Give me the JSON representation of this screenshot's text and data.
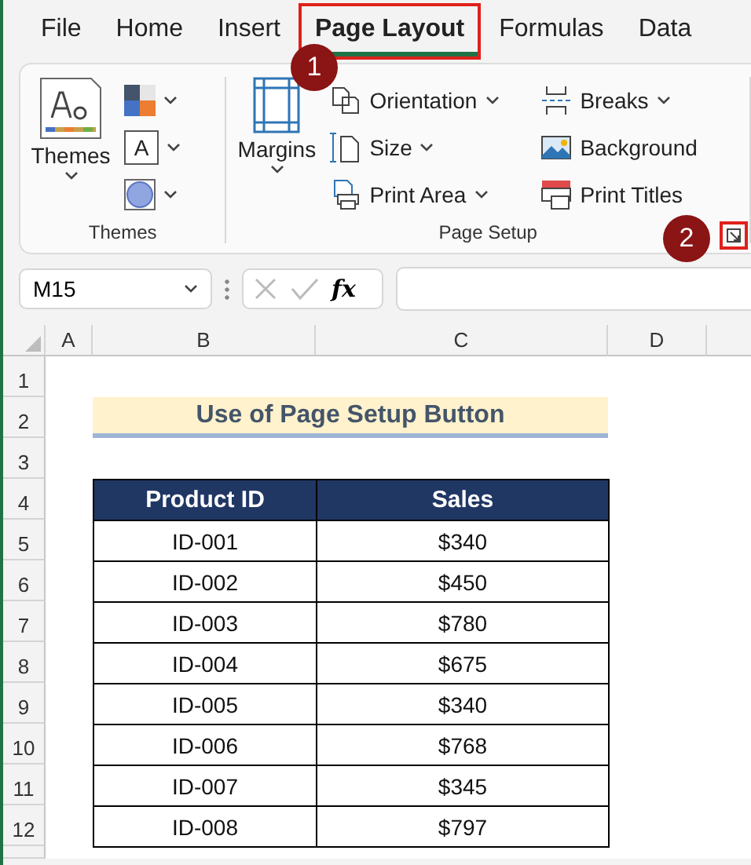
{
  "tabs": [
    {
      "label": "File",
      "selected": false,
      "highlighted": false
    },
    {
      "label": "Home",
      "selected": false,
      "highlighted": false
    },
    {
      "label": "Insert",
      "selected": false,
      "highlighted": false
    },
    {
      "label": "Page Layout",
      "selected": true,
      "highlighted": true
    },
    {
      "label": "Formulas",
      "selected": false,
      "highlighted": false
    },
    {
      "label": "Data",
      "selected": false,
      "highlighted": false
    }
  ],
  "ribbon": {
    "themes_group": {
      "label": "Themes",
      "themes_button": "Themes",
      "font_icon_letter": "A"
    },
    "page_setup_group": {
      "label": "Page Setup",
      "margins_button": "Margins",
      "buttons": [
        {
          "kind": "orientation",
          "label": "Orientation",
          "dropdown": true
        },
        {
          "kind": "size",
          "label": "Size",
          "dropdown": true
        },
        {
          "kind": "print-area",
          "label": "Print Area",
          "dropdown": true
        },
        {
          "kind": "breaks",
          "label": "Breaks",
          "dropdown": true
        },
        {
          "kind": "background",
          "label": "Background",
          "dropdown": false
        },
        {
          "kind": "print-titles",
          "label": "Print Titles",
          "dropdown": false
        }
      ],
      "launcher_highlighted": true
    }
  },
  "annotations": [
    {
      "label": "1"
    },
    {
      "label": "2"
    }
  ],
  "formula_bar": {
    "name_box": "M15",
    "function_label": "fx"
  },
  "sheet": {
    "columns": [
      "A",
      "B",
      "C",
      "D"
    ],
    "row_numbers": [
      "1",
      "2",
      "3",
      "4",
      "5",
      "6",
      "7",
      "8",
      "9",
      "10",
      "11",
      "12"
    ],
    "title": "Use of Page Setup Button",
    "table": {
      "columns": [
        "Product ID",
        "Sales"
      ],
      "rows": [
        [
          "ID-001",
          "$340"
        ],
        [
          "ID-002",
          "$450"
        ],
        [
          "ID-003",
          "$780"
        ],
        [
          "ID-004",
          "$675"
        ],
        [
          "ID-005",
          "$340"
        ],
        [
          "ID-006",
          "$768"
        ],
        [
          "ID-007",
          "$345"
        ],
        [
          "ID-008",
          "$797"
        ]
      ]
    }
  }
}
